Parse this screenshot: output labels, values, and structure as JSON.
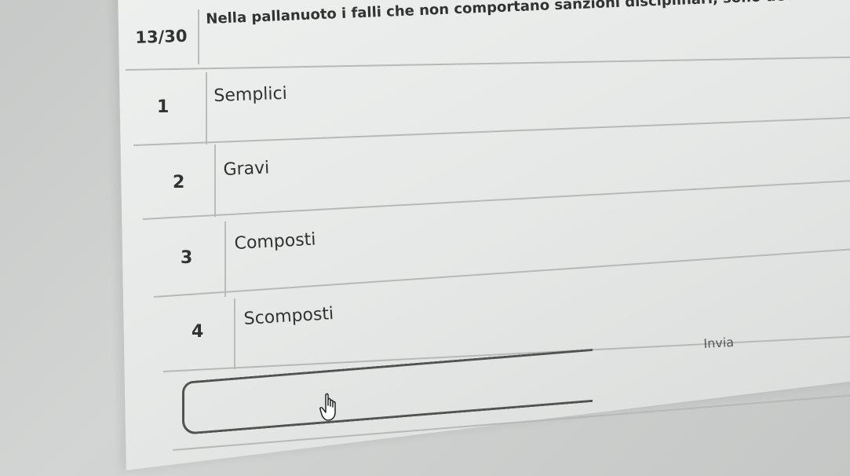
{
  "question": {
    "counter": "13/30",
    "text": "Nella pallanuoto i falli che non comportano sanzioni disciplinari, sono detti:"
  },
  "options": [
    {
      "number": "1",
      "label": "Semplici"
    },
    {
      "number": "2",
      "label": "Gravi"
    },
    {
      "number": "3",
      "label": "Composti"
    },
    {
      "number": "4",
      "label": "Scomposti"
    }
  ],
  "submit": {
    "label": "Invia"
  },
  "icons": {
    "cursor": "hand-pointer-icon"
  }
}
